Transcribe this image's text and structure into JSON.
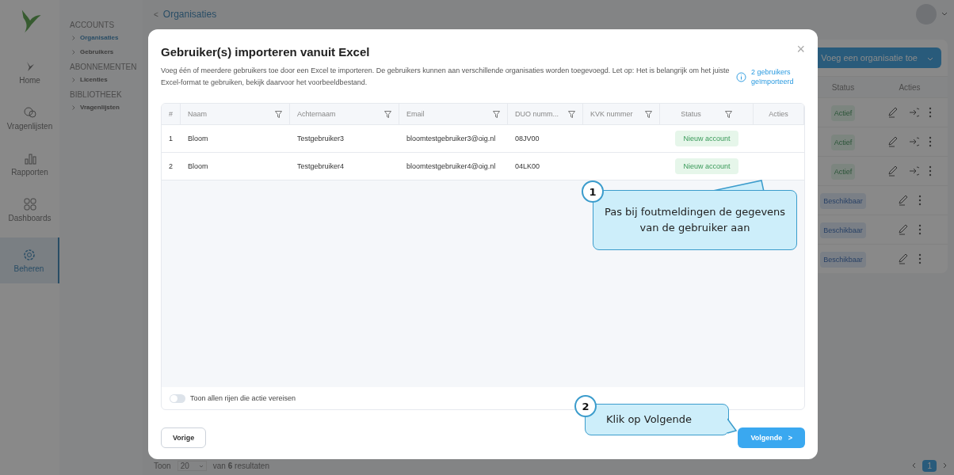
{
  "rail": {
    "items": [
      {
        "label": "Home",
        "selected": false
      },
      {
        "label": "Vragenlijsten",
        "selected": false
      },
      {
        "label": "Rapporten",
        "selected": false
      },
      {
        "label": "Dashboards",
        "selected": false
      },
      {
        "label": "Beheren",
        "selected": true
      }
    ]
  },
  "subnav": {
    "groups": [
      {
        "title": "ACCOUNTS",
        "items": [
          {
            "label": "Organisaties",
            "selected": true
          },
          {
            "label": "Gebruikers",
            "selected": false
          }
        ]
      },
      {
        "title": "ABONNEMENTEN",
        "items": [
          {
            "label": "Licenties",
            "selected": false
          }
        ]
      },
      {
        "title": "BIBLIOTHEEK",
        "items": [
          {
            "label": "Vragenlijsten",
            "selected": false
          }
        ]
      }
    ]
  },
  "page": {
    "back": "<",
    "title": "Organisaties",
    "add_button": "Voeg een organisatie toe",
    "columns": [
      "Status",
      "Acties"
    ],
    "rows": [
      {
        "status": "Actief",
        "kind": "active"
      },
      {
        "status": "Actief",
        "kind": "active"
      },
      {
        "status": "Actief",
        "kind": "active"
      },
      {
        "status": "Beschikbaar",
        "kind": "available"
      },
      {
        "status": "Beschikbaar",
        "kind": "available"
      },
      {
        "status": "Beschikbaar",
        "kind": "available"
      }
    ],
    "footer": {
      "show": "Toon",
      "per_page": "20",
      "summary": "van **6** resultaten"
    },
    "pages": [
      {
        "label": "1",
        "selected": true
      }
    ]
  },
  "modal": {
    "title": "Gebruiker(s) importeren vanuit Excel",
    "close": "×",
    "description": "Voeg één of meerdere gebruikers toe door een Excel te importeren. De gebruikers kunnen aan verschillende organisaties worden toegevoegd. Let op: Het is belangrijk om het juiste Excel-format te gebruiken, bekijk daarvoor het voorbeeldbestand.",
    "imported": "2 gebruikers geïmporteerd",
    "columns": [
      {
        "label": "#",
        "filter": false
      },
      {
        "label": "Naam",
        "filter": true
      },
      {
        "label": "Achternaam",
        "filter": true
      },
      {
        "label": "Email",
        "filter": true
      },
      {
        "label": "DUO numm...",
        "filter": true
      },
      {
        "label": "KVK nummer",
        "filter": true
      },
      {
        "label": "Status",
        "filter": true
      },
      {
        "label": "Acties",
        "filter": false
      }
    ],
    "rows": [
      {
        "num": "1",
        "naam": "Bloom",
        "achternaam": "Testgebruiker3",
        "email": "bloomtestgebruiker3@oig.nl",
        "duo": "08JV00",
        "status": "Nieuw account"
      },
      {
        "num": "2",
        "naam": "Bloom",
        "achternaam": "Testgebruiker4",
        "email": "bloomtestgebruiker4@oig.nl",
        "duo": "04LK00",
        "status": "Nieuw account"
      }
    ],
    "toggle": {
      "label": "Toon allen rijen die actie vereisen",
      "on": false
    },
    "back_button": "Vorige",
    "next_button": "Volgende",
    "next_chevron": ">"
  },
  "callouts": [
    {
      "number": "1",
      "text": "Pas bij foutmeldingen de gegevens van de gebruiker aan"
    },
    {
      "number": "2",
      "text": "Klik op Volgende"
    }
  ]
}
